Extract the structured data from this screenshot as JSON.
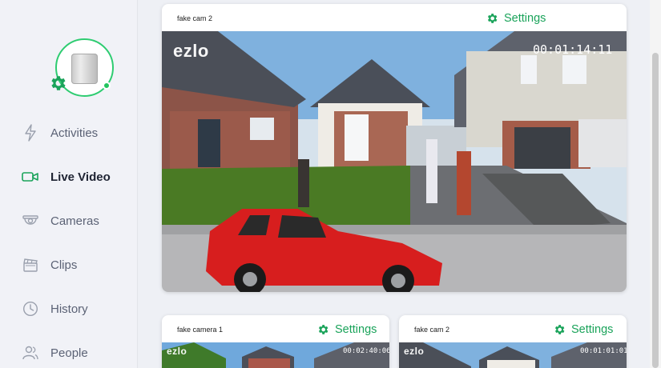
{
  "sidebar": {
    "items": [
      {
        "label": "Activities",
        "icon": "bolt-icon"
      },
      {
        "label": "Live Video",
        "icon": "video-camera-icon",
        "active": true
      },
      {
        "label": "Cameras",
        "icon": "dome-camera-icon"
      },
      {
        "label": "Clips",
        "icon": "clapperboard-icon"
      },
      {
        "label": "History",
        "icon": "clock-icon"
      },
      {
        "label": "People",
        "icon": "people-icon"
      }
    ]
  },
  "main_feed": {
    "title": "fake cam 2",
    "settings_label": "Settings",
    "watermark": "ezlo",
    "timestamp": "00:01:14:11"
  },
  "thumbnails": [
    {
      "title": "fake camera 1",
      "settings_label": "Settings",
      "watermark": "ezlo",
      "timestamp": "00:02:40:06"
    },
    {
      "title": "fake cam 2",
      "settings_label": "Settings",
      "watermark": "ezlo",
      "timestamp": "00:01:01:01"
    }
  ],
  "colors": {
    "accent": "#1aa35a",
    "online": "#22c55e",
    "sidebar_bg": "#f1f2f7"
  }
}
